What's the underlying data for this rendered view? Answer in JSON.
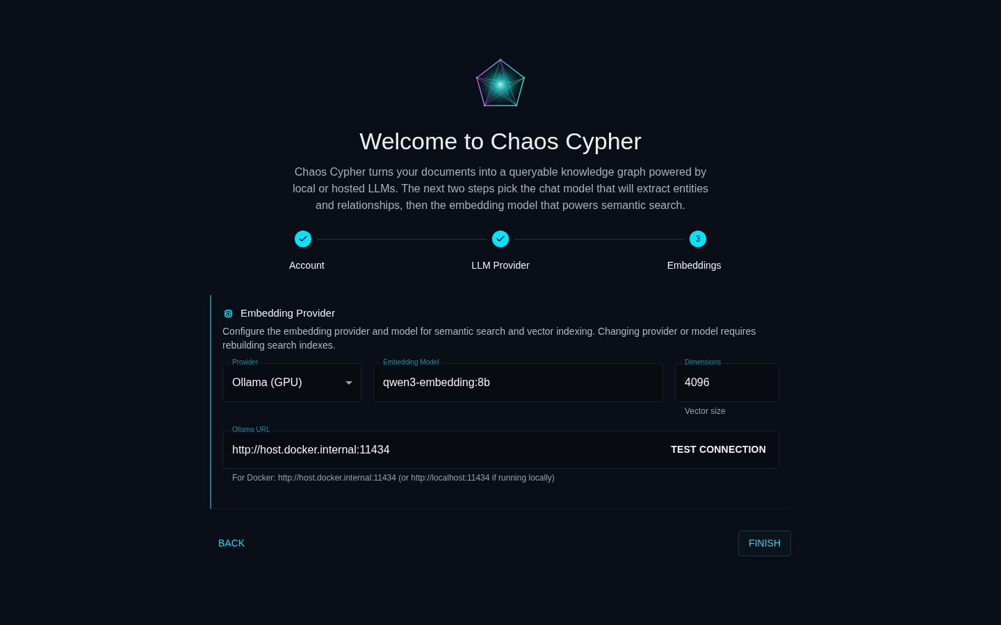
{
  "title": "Welcome to Chaos Cypher",
  "intro": "Chaos Cypher turns your documents into a queryable knowledge graph powered by local or hosted LLMs. The next two steps pick the chat model that will extract entities and relationships, then the embedding model that powers semantic search.",
  "steps": [
    {
      "label": "Account",
      "completed": true
    },
    {
      "label": "LLM Provider",
      "completed": true
    },
    {
      "label": "Embeddings",
      "completed": false,
      "number": "3"
    }
  ],
  "card": {
    "title": "Embedding Provider",
    "description": "Configure the embedding provider and model for semantic search and vector indexing. Changing provider or model requires rebuilding search indexes.",
    "provider": {
      "label": "Provider",
      "value": "Ollama (GPU)"
    },
    "model": {
      "label": "Embedding Model",
      "value": "qwen3-embedding:8b"
    },
    "dimensions": {
      "label": "Dimensions",
      "value": "4096",
      "helper": "Vector size"
    },
    "ollama_url": {
      "label": "Ollama URL",
      "value": "http://host.docker.internal:11434",
      "button": "TEST CONNECTION",
      "helper": "For Docker: http://host.docker.internal:11434 (or http://localhost:11434 if running locally)"
    }
  },
  "buttons": {
    "back": "BACK",
    "finish": "FINISH"
  }
}
